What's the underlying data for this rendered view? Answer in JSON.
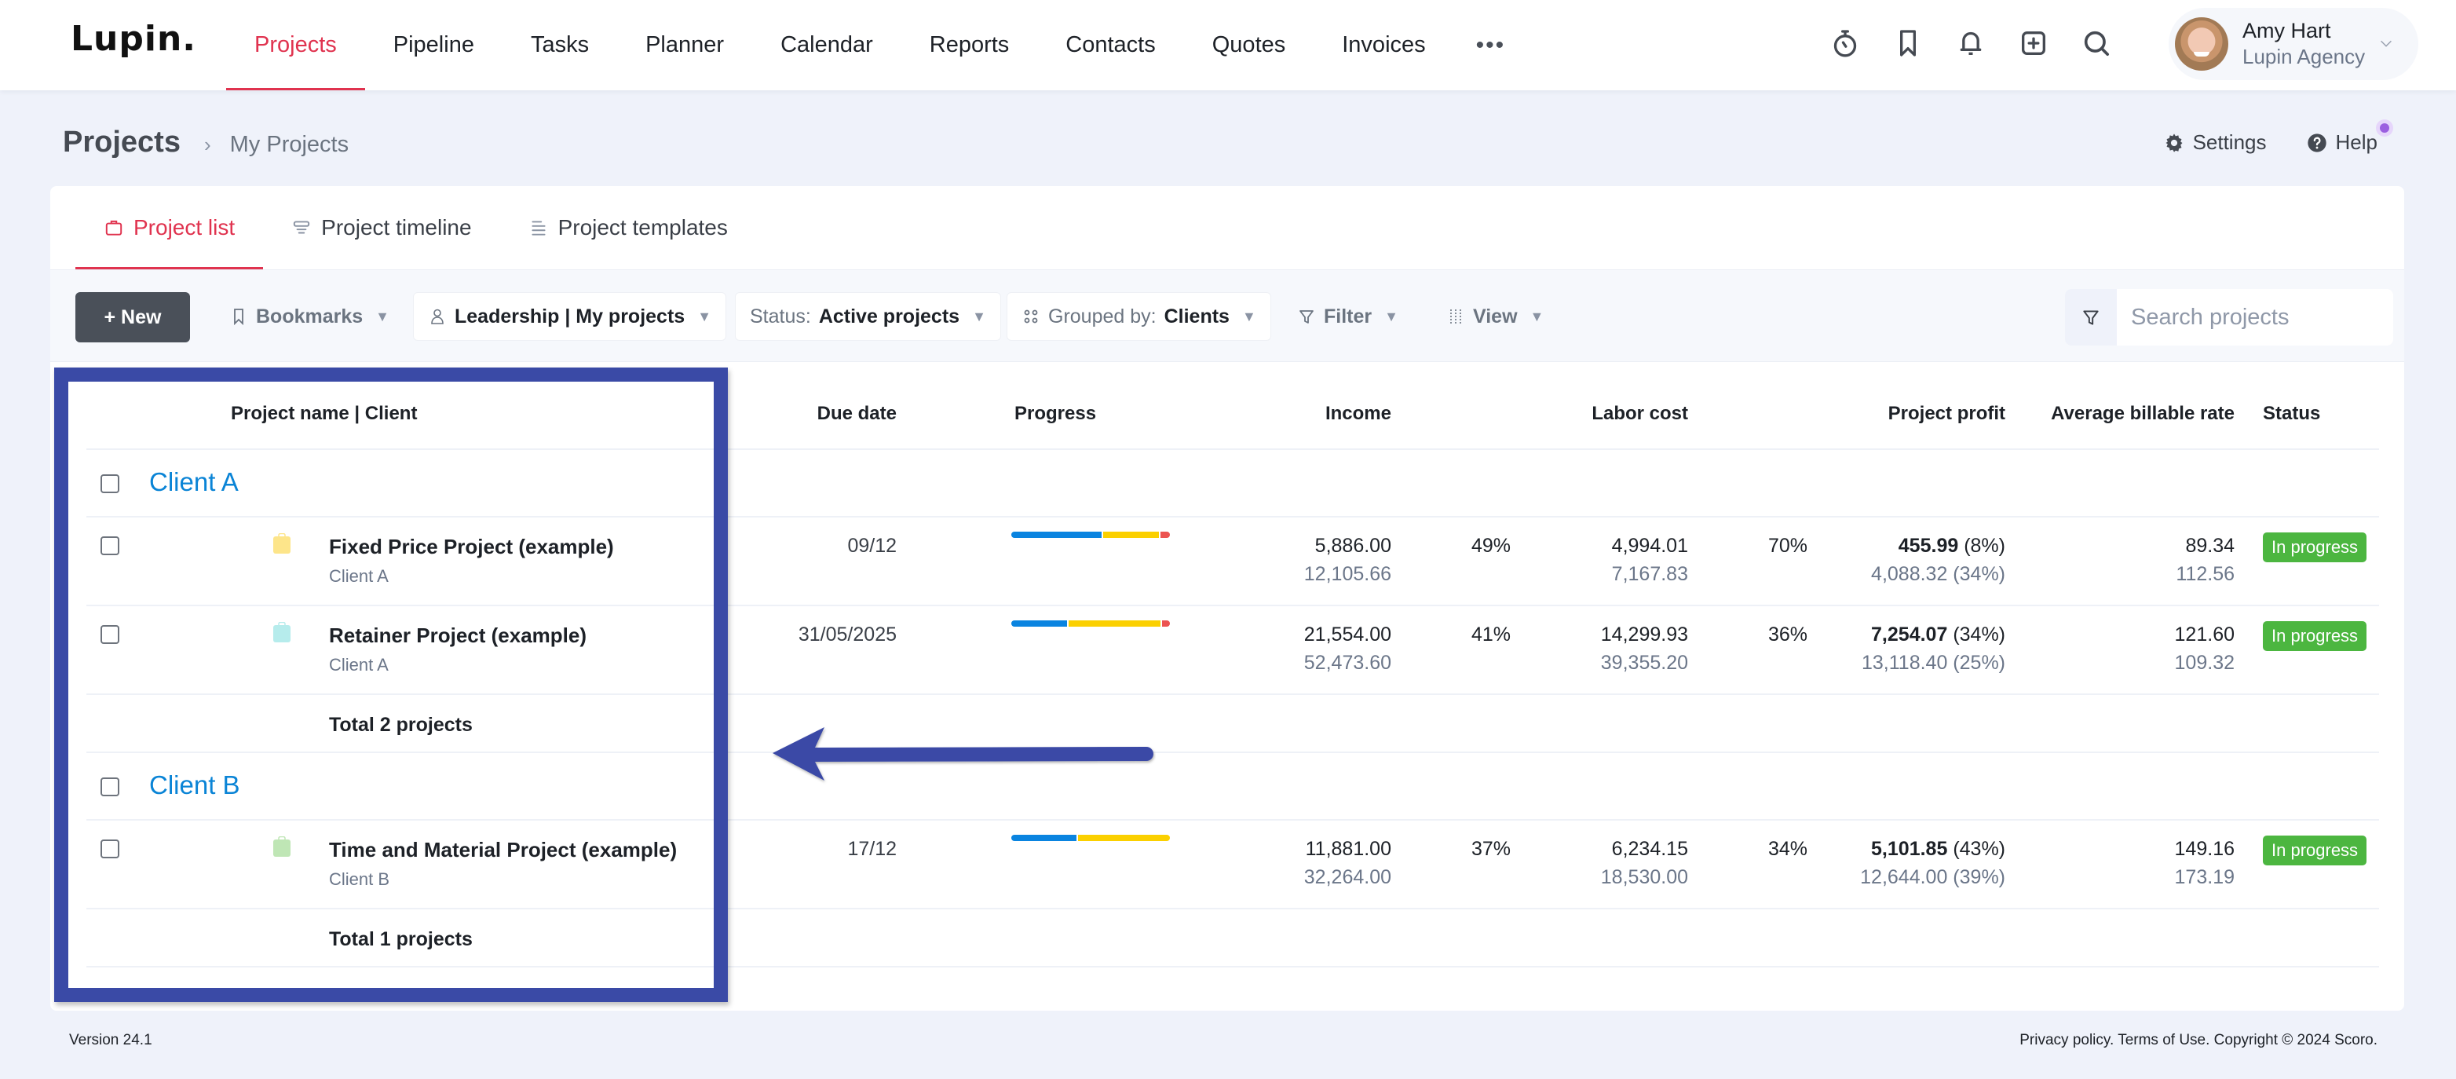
{
  "app": {
    "logo": "Lupin."
  },
  "nav": {
    "items": [
      {
        "label": "Projects",
        "active": true
      },
      {
        "label": "Pipeline"
      },
      {
        "label": "Tasks"
      },
      {
        "label": "Planner"
      },
      {
        "label": "Calendar"
      },
      {
        "label": "Reports"
      },
      {
        "label": "Contacts"
      },
      {
        "label": "Quotes"
      },
      {
        "label": "Invoices"
      }
    ],
    "more_label": "•••",
    "icons": [
      "stopwatch-icon",
      "bookmark-icon",
      "bell-icon",
      "add-icon",
      "search-icon"
    ]
  },
  "user": {
    "name": "Amy Hart",
    "org": "Lupin Agency"
  },
  "breadcrumb": {
    "root": "Projects",
    "separator": "›",
    "current": "My Projects"
  },
  "page_actions": {
    "settings": "Settings",
    "help": "Help"
  },
  "tabs": [
    {
      "label": "Project list",
      "active": true
    },
    {
      "label": "Project timeline"
    },
    {
      "label": "Project templates"
    }
  ],
  "toolbar": {
    "new_label": "+ New",
    "bookmarks": "Bookmarks",
    "view_selector": "Leadership | My projects",
    "status_prefix": "Status:",
    "status_value": "Active projects",
    "group_prefix": "Grouped by:",
    "group_value": "Clients",
    "filter": "Filter",
    "view": "View",
    "search_placeholder": "Search projects"
  },
  "table": {
    "columns": {
      "name": "Project name | Client",
      "due": "Due date",
      "progress": "Progress",
      "income": "Income",
      "labor": "Labor cost",
      "profit": "Project profit",
      "rate": "Average billable rate",
      "status": "Status"
    },
    "groups": [
      {
        "client": "Client A",
        "total": "Total 2 projects",
        "projects": [
          {
            "name": "Fixed Price Project (example)",
            "client": "Client A",
            "icon_color": "#fde58a",
            "due": "09/12",
            "progress": {
              "blue": 0.57,
              "yellow": 0.35,
              "red": 0.06
            },
            "income": "5,886.00",
            "income_sub": "12,105.66",
            "income_pct": "49%",
            "labor": "4,994.01",
            "labor_sub": "7,167.83",
            "labor_pct": "70%",
            "profit": "455.99",
            "profit_pct": "(8%)",
            "profit_sub": "4,088.32 (34%)",
            "rate": "89.34",
            "rate_sub": "112.56",
            "status": "In progress"
          },
          {
            "name": "Retainer Project (example)",
            "client": "Client A",
            "icon_color": "#b6ecec",
            "due": "31/05/2025",
            "progress": {
              "blue": 0.35,
              "yellow": 0.58,
              "red": 0.05
            },
            "income": "21,554.00",
            "income_sub": "52,473.60",
            "income_pct": "41%",
            "labor": "14,299.93",
            "labor_sub": "39,355.20",
            "labor_pct": "36%",
            "profit": "7,254.07",
            "profit_pct": "(34%)",
            "profit_sub": "13,118.40 (25%)",
            "rate": "121.60",
            "rate_sub": "109.32",
            "status": "In progress"
          }
        ]
      },
      {
        "client": "Client B",
        "total": "Total 1 projects",
        "projects": [
          {
            "name": "Time and Material Project (example)",
            "client": "Client B",
            "icon_color": "#bfe6b5",
            "due": "17/12",
            "progress": {
              "blue": 0.41,
              "yellow": 0.58,
              "red": 0
            },
            "income": "11,881.00",
            "income_sub": "32,264.00",
            "income_pct": "37%",
            "labor": "6,234.15",
            "labor_sub": "18,530.00",
            "labor_pct": "34%",
            "profit": "5,101.85",
            "profit_pct": "(43%)",
            "profit_sub": "12,644.00 (39%)",
            "rate": "149.16",
            "rate_sub": "173.19",
            "status": "In progress"
          }
        ]
      }
    ]
  },
  "colors": {
    "accent": "#e0334f",
    "client_link": "#0a84d6",
    "progress_blue": "#0a84e0",
    "progress_yellow": "#fbd000",
    "progress_red": "#ec5350",
    "status_green": "#4cb640",
    "highlight": "#3a4aa6"
  },
  "footer": {
    "version": "Version 24.1",
    "legal": "Privacy policy. Terms of Use. Copyright © 2024 Scoro."
  }
}
